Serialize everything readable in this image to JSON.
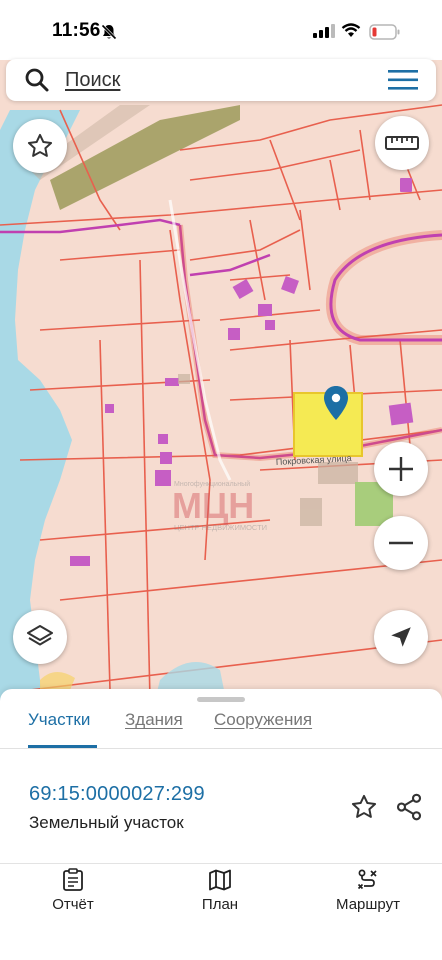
{
  "status_bar": {
    "time": "11:56"
  },
  "search": {
    "placeholder": "Поиск"
  },
  "map": {
    "street_label": "Покровская улица",
    "watermark_main": "МЦН",
    "watermark_top": "Многофункциональный",
    "watermark_bottom": "ЦЕНТР НЕДВИЖИМОСТИ"
  },
  "tabs": [
    {
      "label": "Участки",
      "active": true
    },
    {
      "label": "Здания",
      "active": false
    },
    {
      "label": "Сооружения",
      "active": false
    }
  ],
  "parcel": {
    "cadastral_number": "69:15:0000027:299",
    "type": "Земельный участок"
  },
  "bottom_nav": [
    {
      "label": "Отчёт",
      "icon": "report-icon"
    },
    {
      "label": "План",
      "icon": "map-plan-icon"
    },
    {
      "label": "Маршрут",
      "icon": "route-icon"
    }
  ],
  "colors": {
    "accent": "#1d6fa5",
    "map_background": "#f6dcd0",
    "water": "#a9d9e6",
    "parcel_border": "#e8604e",
    "selected_parcel": "#f5ea53",
    "road_purple": "#c040b0",
    "building": "#c65ec4",
    "green_area": "#a8cd7c"
  }
}
